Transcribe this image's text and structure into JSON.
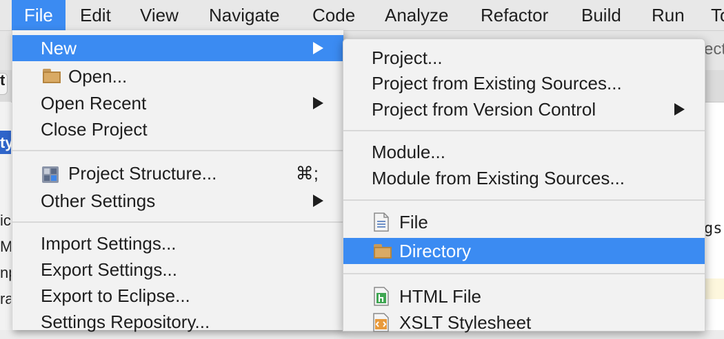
{
  "menubar": {
    "items": [
      "File",
      "Edit",
      "View",
      "Navigate",
      "Code",
      "Analyze",
      "Refactor",
      "Build",
      "Run",
      "To"
    ]
  },
  "background": {
    "left_glyph_1": "t",
    "left_glyph_2": "ty",
    "left_lines": [
      "ic",
      "M",
      "np",
      "ra"
    ],
    "right_top": "ect",
    "right_code": "gs)"
  },
  "file_menu": {
    "new": "New",
    "open": "Open...",
    "open_recent": "Open Recent",
    "close_project": "Close Project",
    "project_structure": "Project Structure...",
    "project_structure_shortcut": "⌘;",
    "other_settings": "Other Settings",
    "import_settings": "Import Settings...",
    "export_settings": "Export Settings...",
    "export_eclipse": "Export to Eclipse...",
    "settings_repository": "Settings Repository..."
  },
  "new_submenu": {
    "project": "Project...",
    "project_existing": "Project from Existing Sources...",
    "project_vcs": "Project from Version Control",
    "module": "Module...",
    "module_existing": "Module from Existing Sources...",
    "file": "File",
    "directory": "Directory",
    "html_file": "HTML File",
    "xslt": "XSLT Stylesheet"
  },
  "colors": {
    "highlight": "#3b8bf2",
    "menu_bg": "#f2f2f2",
    "folder": "#d9aa64"
  },
  "icons": [
    "folder-icon",
    "project-structure-icon",
    "file-icon",
    "html-file-icon",
    "xslt-icon",
    "submenu-arrow-icon"
  ]
}
